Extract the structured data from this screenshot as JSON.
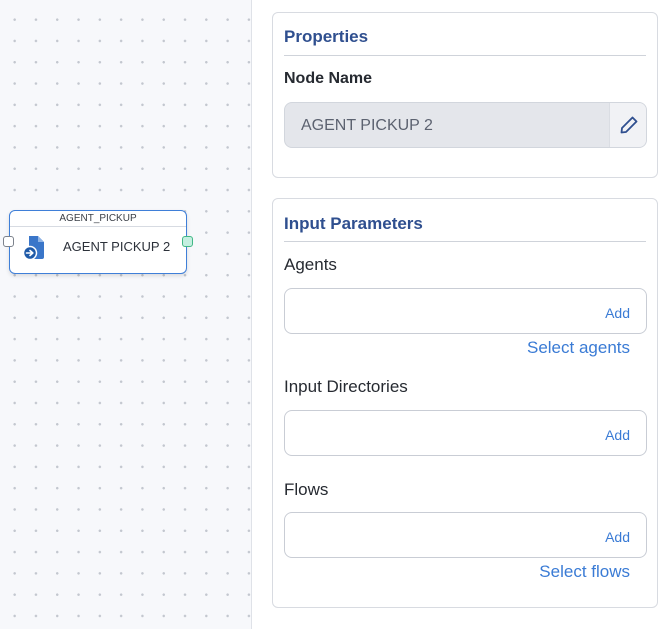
{
  "canvas": {
    "node": {
      "type_label": "AGENT_PICKUP",
      "title": "AGENT PICKUP 2",
      "icon": "file-arrow-icon",
      "accent_color": "#3f7fd8",
      "output_port_color": "#42b886"
    }
  },
  "properties": {
    "heading": "Properties",
    "node_name_label": "Node Name",
    "node_name_value": "AGENT PICKUP 2",
    "edit_icon": "pencil-icon"
  },
  "input_parameters": {
    "heading": "Input Parameters",
    "agents": {
      "label": "Agents",
      "add_label": "Add",
      "select_label": "Select agents"
    },
    "input_directories": {
      "label": "Input Directories",
      "add_label": "Add"
    },
    "flows": {
      "label": "Flows",
      "add_label": "Add",
      "select_label": "Select flows"
    }
  },
  "colors": {
    "heading": "#2f4f8f",
    "link": "#3a7bd5"
  }
}
